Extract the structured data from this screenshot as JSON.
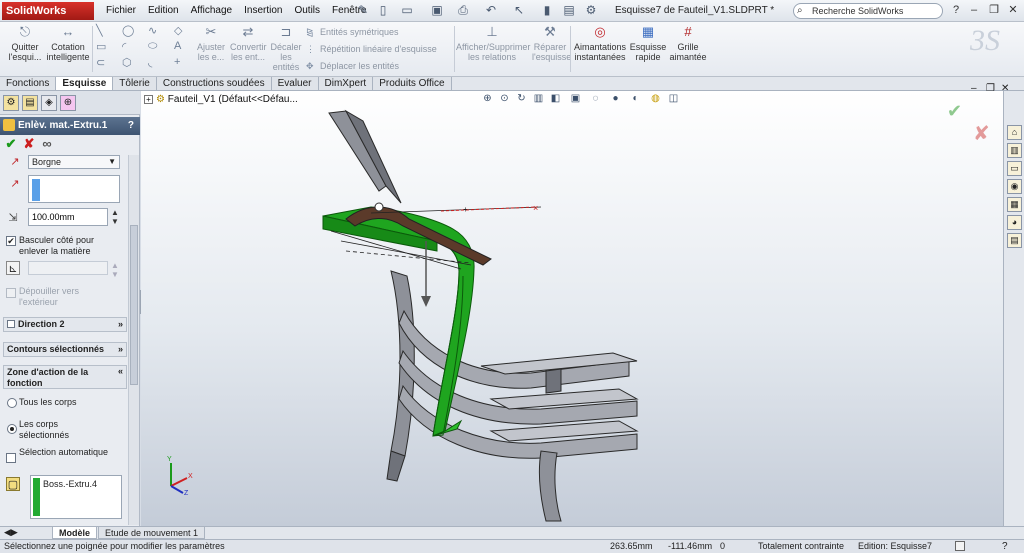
{
  "app": {
    "logo": "SolidWorks",
    "menus": [
      "Fichier",
      "Edition",
      "Affichage",
      "Insertion",
      "Outils",
      "Fenêtre"
    ],
    "document_title": "Esquisse7 de Fauteil_V1.SLDPRT *",
    "search_placeholder": "Recherche SolidWorks"
  },
  "ribbon": {
    "quit_sketch": "Quitter l'esqui...",
    "smart_dimension": "Cotation intelligente",
    "trim": "Ajuster les e...",
    "convert": "Convertir les ent...",
    "offset": "Décaler les entités",
    "mirror": "Entités symétriques",
    "linear_pattern": "Répétition linéaire d'esquisse",
    "move": "Déplacer les entités",
    "show_relations": "Afficher/Supprimer les relations",
    "repair": "Réparer l'esquisse",
    "instant_snaps": "Aimantations instantanées",
    "rapid_sketch": "Esquisse rapide",
    "magnet_grid": "Grille aimantée"
  },
  "command_tabs": [
    "Fonctions",
    "Esquisse",
    "Tôlerie",
    "Constructions soudées",
    "Evaluer",
    "DimXpert",
    "Produits Office"
  ],
  "active_tab": "Esquisse",
  "property_manager": {
    "title": "Enlèv. mat.-Extru.1",
    "help": "?",
    "end_condition": "Borgne",
    "depth": "100.00mm",
    "flip_side_label": "Basculer côté pour enlever la matière",
    "flip_side_checked": true,
    "draft_outward_label": "Dépouiller vers l'extérieur",
    "direction2": "Direction 2",
    "selected_contours": "Contours sélectionnés",
    "feature_scope": "Zone d'action de la fonction",
    "all_bodies": "Tous les corps",
    "selected_bodies": "Les corps sélectionnés",
    "auto_select": "Sélection automatique",
    "body_item": "Boss.-Extru.4"
  },
  "viewport": {
    "tree_root": "Fauteil_V1  (Défaut<<Défau..."
  },
  "bottom_tabs": [
    "Modèle",
    "Etude de mouvement 1"
  ],
  "status": {
    "message": "Sélectionnez une poignée pour modifier les paramètres",
    "x": "263.65mm",
    "y": "-111.46mm",
    "z": "0",
    "state": "Totalement contrainte",
    "edit": "Edition: Esquisse7"
  },
  "colors": {
    "accent_green": "#22aa22",
    "chair_gray": "#8c8f96",
    "header_blue": "#4a6180"
  }
}
